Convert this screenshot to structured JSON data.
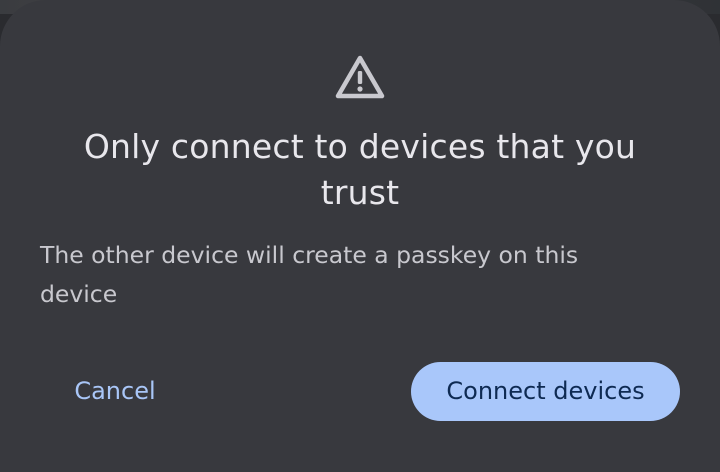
{
  "dialog": {
    "icon": "warning-triangle-icon",
    "title": "Only connect to devices that you trust",
    "body": "The other device will create a passkey on this device",
    "cancel_label": "Cancel",
    "confirm_label": "Connect devices"
  },
  "colors": {
    "surface": "#38393e",
    "title_text": "#e8e7ec",
    "body_text": "#c8c8ce",
    "accent": "#a9c7fa",
    "on_accent": "#0e2a52"
  }
}
